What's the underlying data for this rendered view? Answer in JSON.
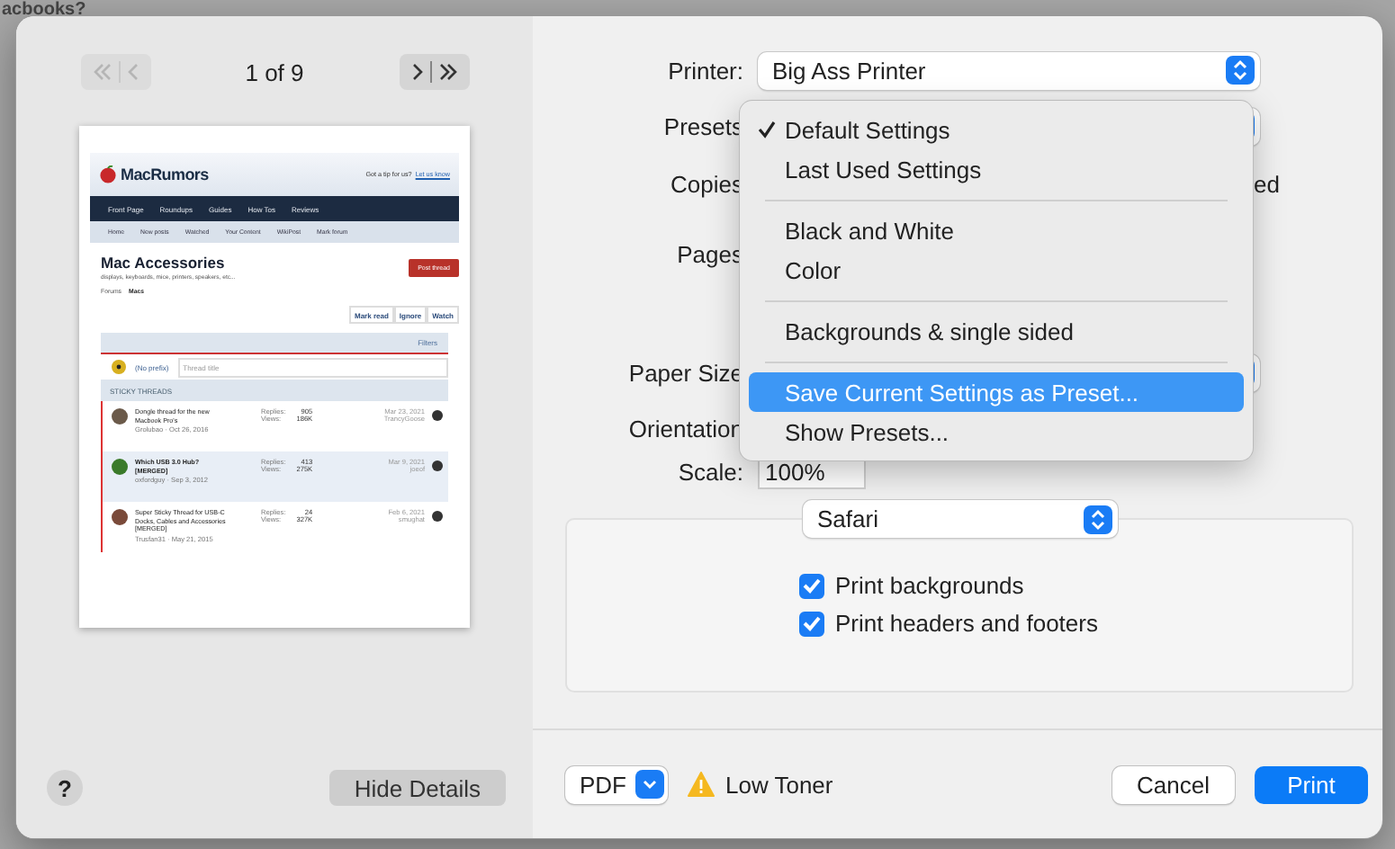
{
  "background": {
    "heading": "acbooks?"
  },
  "preview": {
    "nav": [
      {
        "kind": "back",
        "disabled": true
      },
      {
        "kind": "forward",
        "disabled": false
      }
    ],
    "page_indicator": "1 of 9",
    "page": {
      "logo": "MacRumors",
      "tip": "Got a tip for us?",
      "tip_link": "Let us know",
      "nav": [
        "Front Page",
        "Roundups",
        "Guides",
        "How Tos",
        "Reviews"
      ],
      "subnav": [
        "Home",
        "New posts",
        "Watched",
        "Your Content",
        "WikiPost",
        "Mark forum"
      ],
      "title": "Mac Accessories",
      "subtitle": "displays, keyboards, mice, printers, speakers, etc...",
      "breadcrumb": [
        "Forums",
        "Macs"
      ],
      "post_button": "Post thread",
      "actions": [
        "Mark read",
        "Ignore",
        "Watch"
      ],
      "filters": "Filters",
      "prefix": "(No prefix)",
      "thread_placeholder": "Thread title",
      "sticky_header": "STICKY THREADS",
      "threads": [
        {
          "title": "Dongle thread for the new Macbook Pro's",
          "meta": "Grolubao · Oct 26, 2016",
          "replies_label": "Replies:",
          "replies": "905",
          "views_label": "Views:",
          "views": "186K",
          "date": "Mar 23, 2021",
          "user": "TrancyGoose",
          "highlighted": false
        },
        {
          "title": "Which USB 3.0 Hub? [MERGED]",
          "meta": "oxfordguy · Sep 3, 2012",
          "replies_label": "Replies:",
          "replies": "413",
          "views_label": "Views:",
          "views": "275K",
          "date": "Mar 9, 2021",
          "user": "joeof",
          "highlighted": true
        },
        {
          "title": "Super Sticky Thread for USB-C Docks, Cables and Accessories [MERGED]",
          "meta": "Trusfan31 · May 21, 2015",
          "replies_label": "Replies:",
          "replies": "24",
          "views_label": "Views:",
          "views": "327K",
          "date": "Feb 6, 2021",
          "user": "smughat",
          "highlighted": false
        }
      ]
    },
    "help_button": "?",
    "hide_details_button": "Hide Details"
  },
  "settings": [
    {
      "kind": "popup",
      "label": "Printer:",
      "value": "Big Ass Printer"
    },
    {
      "kind": "popup",
      "label": "Presets"
    },
    {
      "kind": "text",
      "label": "Copies",
      "trailing": "ed"
    },
    {
      "kind": "plain",
      "label": "Pages"
    },
    {
      "kind": "popup",
      "label": "Paper Size"
    },
    {
      "kind": "plain",
      "label": "Orientation"
    },
    {
      "kind": "field",
      "label": "Scale:",
      "value": "100%"
    }
  ],
  "presets_menu": [
    {
      "kind": "item",
      "label": "Default Settings",
      "checked": true,
      "selected": false
    },
    {
      "kind": "item",
      "label": "Last Used Settings",
      "checked": false,
      "selected": false
    },
    {
      "kind": "separator"
    },
    {
      "kind": "item",
      "label": "Black and White",
      "checked": false,
      "selected": false
    },
    {
      "kind": "item",
      "label": "Color",
      "checked": false,
      "selected": false
    },
    {
      "kind": "separator"
    },
    {
      "kind": "item",
      "label": "Backgrounds & single sided",
      "checked": false,
      "selected": false
    },
    {
      "kind": "separator"
    },
    {
      "kind": "item",
      "label": "Save Current Settings as Preset...",
      "checked": false,
      "selected": true
    },
    {
      "kind": "item",
      "label": "Show Presets...",
      "checked": false,
      "selected": false
    }
  ],
  "app_section": {
    "popup": "Safari",
    "options": [
      {
        "label": "Print backgrounds",
        "checked": true
      },
      {
        "label": "Print headers and footers",
        "checked": true
      }
    ]
  },
  "footer": {
    "pdf_button": "PDF",
    "warning": "Low Toner",
    "cancel_button": "Cancel",
    "print_button": "Print"
  }
}
